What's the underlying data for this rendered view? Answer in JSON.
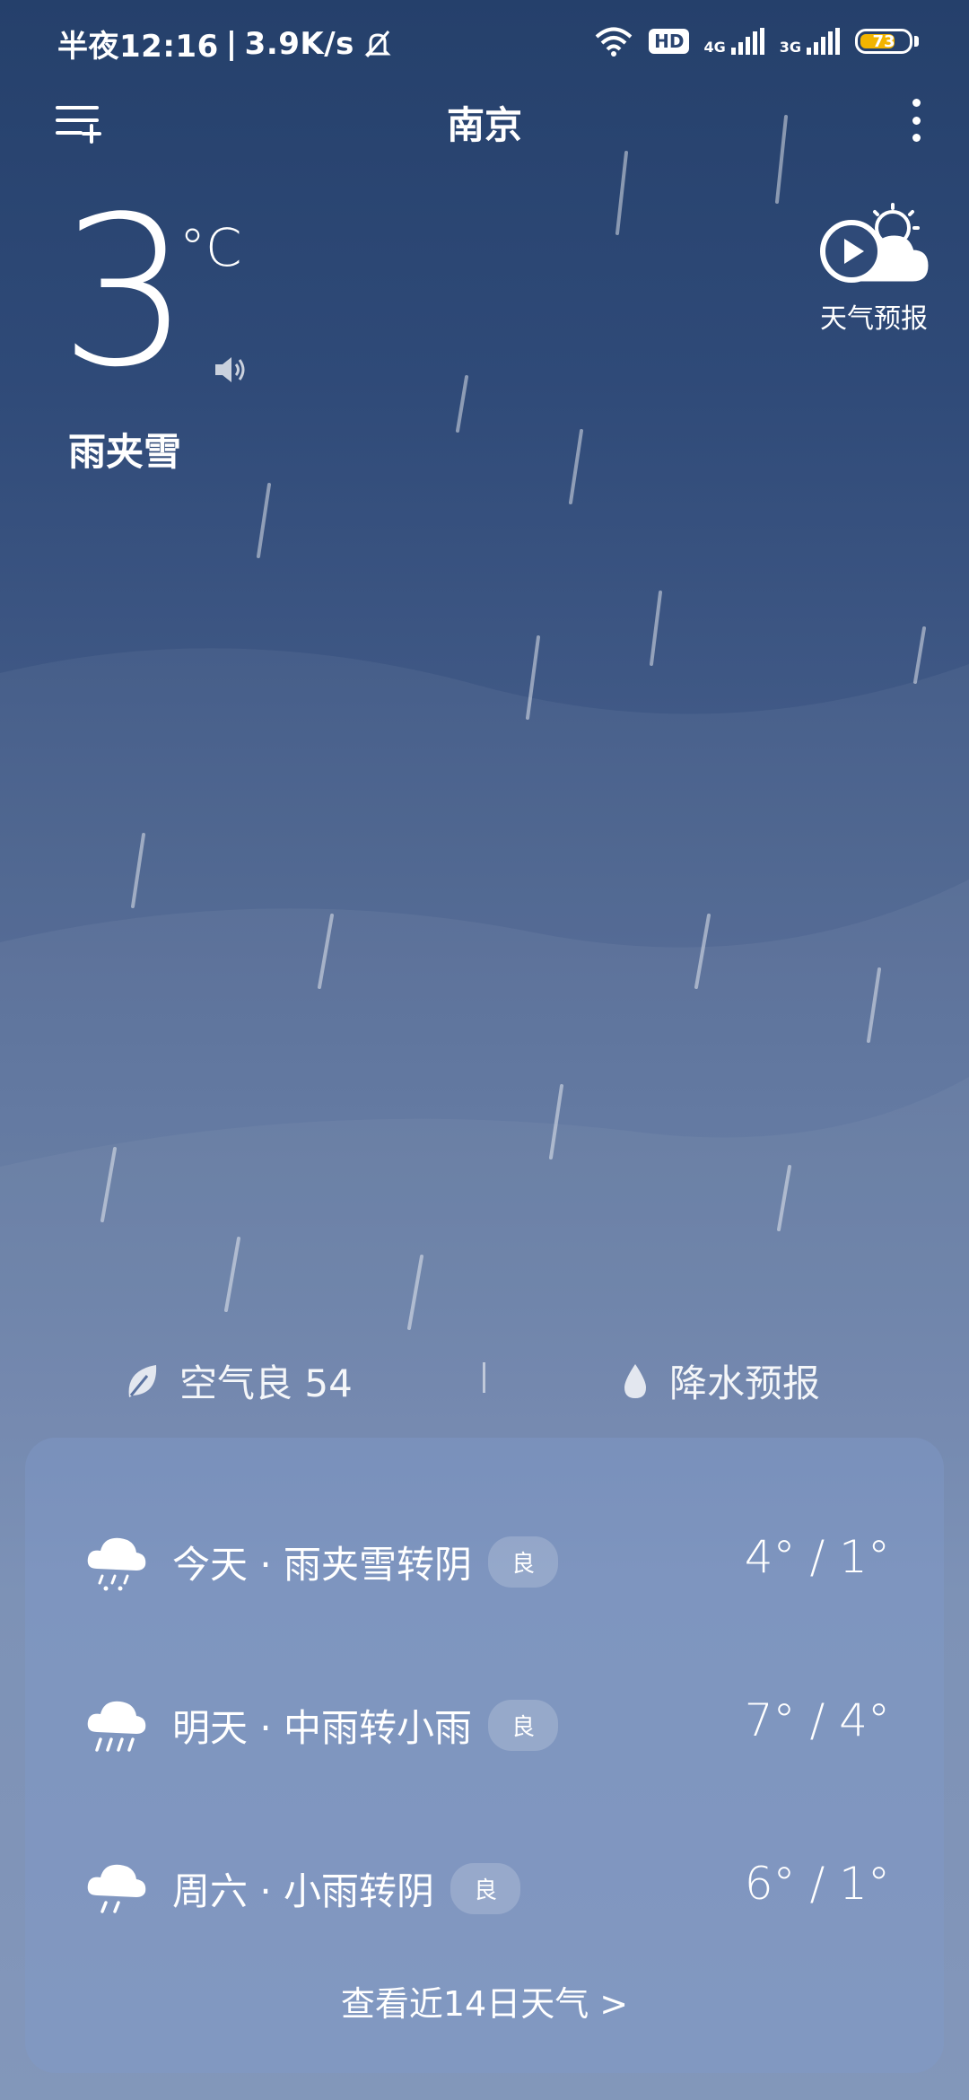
{
  "status_bar": {
    "time": "半夜12:16",
    "speed": "3.9K/s",
    "hd": "HD",
    "net1": "4G",
    "net2": "3G",
    "battery": "73",
    "battery_level": 0.73
  },
  "header": {
    "city": "南京"
  },
  "current": {
    "temperature": "3",
    "unit": "°C",
    "condition": "雨夹雪",
    "forecast_video_label": "天气预报"
  },
  "air": {
    "quality": "空气良 54",
    "precip": "降水预报"
  },
  "days": [
    {
      "label": "今天 · 雨夹雪转阴",
      "aqi": "良",
      "temp": "4° / 1°",
      "icon": "sleet-icon"
    },
    {
      "label": "明天 · 中雨转小雨",
      "aqi": "良",
      "temp": "7° / 4°",
      "icon": "rain-icon"
    },
    {
      "label": "周六 · 小雨转阴",
      "aqi": "良",
      "temp": "6° / 1°",
      "icon": "light-rain-icon"
    }
  ],
  "more_link": "查看近14日天气  >",
  "colors": {
    "battery": "#f2b400",
    "bg_top": "#25406b",
    "bg_bottom": "#7088b2"
  }
}
